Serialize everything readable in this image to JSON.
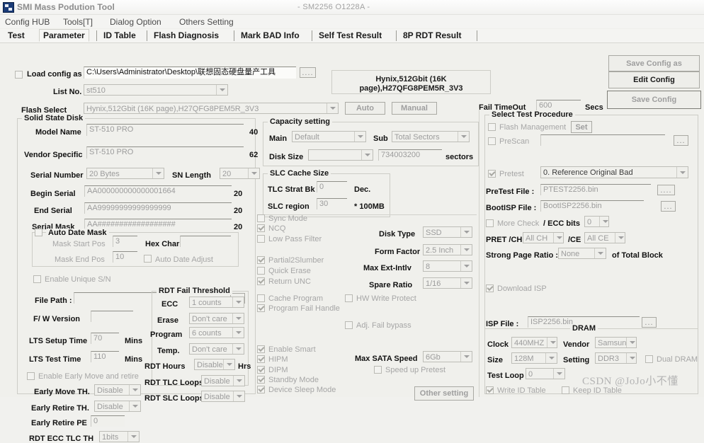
{
  "window": {
    "title": "SMI Mass Podution Tool",
    "subtitle": "- SM2256 O1228A -",
    "icon": "app-icon"
  },
  "menu": [
    "Config HUB",
    "Tools[T]",
    "Dialog Option",
    "Others Setting"
  ],
  "tabs": [
    {
      "label": "Test",
      "selected": false
    },
    {
      "label": "Parameter",
      "selected": true
    },
    {
      "label": "ID Table",
      "selected": false
    },
    {
      "label": "Flash Diagnosis",
      "selected": false
    },
    {
      "label": "Mark BAD Info",
      "selected": false
    },
    {
      "label": "Self Test Result",
      "selected": false
    },
    {
      "label": "8P RDT Result",
      "selected": false
    }
  ],
  "config": {
    "load_config_as_label": "Load config as",
    "load_config_as_checked": false,
    "config_path": "C:\\Users\\Administrator\\Desktop\\联想固态硬盘量产工具",
    "browse_label": "....",
    "list_no_label": "List No.",
    "list_no_value": "st510",
    "flash_select_label": "Flash Select",
    "flash_select_value": "Hynix,512Gbit (16K page),H27QFG8PEM5R_3V3",
    "auto_label": "Auto",
    "manual_label": "Manual",
    "flash_info": "Hynix,512Gbit (16K page),H27QFG8PEM5R_3V3",
    "fail_timeout_label": "Fail TimeOut",
    "fail_timeout_value": "600",
    "secs_label": "Secs",
    "save_config_as_label": "Save Config as",
    "edit_config_label": "Edit Config",
    "save_config_label": "Save Config"
  },
  "ssd": {
    "group_title": "Solid State Disk",
    "model_name_label": "Model Name",
    "model_name_value": "ST-510 PRO",
    "model_name_len": "40",
    "vendor_specific_label": "Vendor Specific",
    "vendor_specific_value": "ST-510 PRO",
    "vendor_specific_len": "62",
    "serial_number_label": "Serial Number",
    "serial_number_value": "20 Bytes",
    "sn_length_label": "SN Length",
    "sn_length_value": "20",
    "begin_serial_label": "Begin Serial",
    "begin_serial_value": "AA000000000000001664",
    "begin_serial_len": "20",
    "end_serial_label": "End Serial",
    "end_serial_value": "AA99999999999999999",
    "end_serial_len": "20",
    "serial_mask_label": "Serial Mask",
    "serial_mask_value": "AA##################",
    "serial_mask_len": "20",
    "auto_date_mask_label": "Auto Date Mask",
    "auto_date_mask_checked": false,
    "mask_start_pos_label": "Mask Start Pos",
    "mask_start_pos_value": "3",
    "mask_end_pos_label": "Mask End Pos",
    "mask_end_pos_value": "10",
    "hex_char_label": "Hex Char:",
    "hex_char_value": "",
    "auto_date_adjust_label": "Auto Date Adjust",
    "auto_date_adjust_checked": false,
    "enable_unique_sn_label": "Enable Unique S/N",
    "enable_unique_sn_checked": false,
    "file_path_label": "File Path :",
    "file_path_value": "",
    "file_path_browse": "....",
    "fw_version_label": "F/ W Version",
    "fw_version_value": "",
    "lts_setup_time_label": "LTS Setup Time",
    "lts_setup_time_value": "70",
    "lts_setup_time_unit": "Mins",
    "lts_test_time_label": "LTS Test Time",
    "lts_test_time_value": "110",
    "lts_test_time_unit": "Mins",
    "enable_early_move_label": "Enable Early Move and retire",
    "enable_early_move_checked": false,
    "early_move_th_label": "Early Move TH.",
    "early_move_th_value": "Disable",
    "early_retire_th_label": "Early Retire TH.",
    "early_retire_th_value": "Disable",
    "early_retire_pe_label": "Early Retire PE",
    "early_retire_pe_value": "0",
    "rdt_ecc_tlc_th_label": "RDT ECC TLC TH",
    "rdt_ecc_tlc_th_value": "1bits"
  },
  "rdt_fail_threshold": {
    "group_title": "RDT Fail Threshold",
    "ecc_label": "ECC",
    "ecc_value": "1 counts",
    "erase_label": "Erase",
    "erase_value": "Don't care",
    "program_label": "Program",
    "program_value": "6 counts",
    "temp_label": "Temp.",
    "temp_value": "Don't care",
    "rdt_hours_label": "RDT Hours",
    "rdt_hours_value": "Disable",
    "rdt_hours_unit": "Hrs",
    "rdt_tlc_loops_label": "RDT TLC Loops",
    "rdt_tlc_loops_value": "Disable",
    "rdt_slc_loops_label": "RDT SLC Loops",
    "rdt_slc_loops_value": "Disable"
  },
  "capacity": {
    "group_title": "Capacity setting",
    "main_label": "Main",
    "main_value": "Default",
    "sub_label": "Sub",
    "sub_value": "Total Sectors",
    "disk_size_label": "Disk Size",
    "disk_size_value": "",
    "total_sectors_value": "734003200",
    "sectors_label": "sectors"
  },
  "slc_cache": {
    "group_title": "SLC Cache Size",
    "tlc_strat_bk_label": "TLC Strat Bk",
    "tlc_strat_bk_value": "0",
    "dec_label": "Dec.",
    "slc_region_label": "SLC region",
    "slc_region_value": "30",
    "mb_label": "* 100MB"
  },
  "flags": [
    {
      "label": "Sync Mode",
      "checked": false
    },
    {
      "label": "NCQ",
      "checked": true
    },
    {
      "label": "Low Pass Filter",
      "checked": false
    },
    {
      "label": "Partial2Slumber",
      "checked": true
    },
    {
      "label": "Quick Erase",
      "checked": false
    },
    {
      "label": "Return UNC",
      "checked": true
    },
    {
      "label": "Cache Program",
      "checked": false
    },
    {
      "label": "Program Fail Handle",
      "checked": true
    },
    {
      "label": "Enable Smart",
      "checked": true
    },
    {
      "label": "HIPM",
      "checked": true
    },
    {
      "label": "DIPM",
      "checked": true
    },
    {
      "label": "Standby Mode",
      "checked": true
    },
    {
      "label": "Device Sleep Mode",
      "checked": true
    }
  ],
  "disk": {
    "disk_type_label": "Disk Type",
    "disk_type_value": "SSD",
    "form_factor_label": "Form Factor",
    "form_factor_value": "2.5 Inch",
    "max_ext_intlv_label": "Max Ext-Intlv",
    "max_ext_intlv_value": "8",
    "spare_ratio_label": "Spare Ratio",
    "spare_ratio_value": "1/16",
    "hw_write_protect_label": "HW Write Protect",
    "hw_write_protect_checked": false,
    "adj_fail_bypass_label": "Adj. Fail bypass",
    "adj_fail_bypass_checked": false,
    "max_sata_speed_label": "Max SATA Speed",
    "max_sata_speed_value": "6Gb",
    "speed_up_pretest_label": "Speed up Pretest",
    "speed_up_pretest_checked": false,
    "other_setting_label": "Other setting"
  },
  "test_procedure": {
    "group_title": "Select Test Procedure",
    "flash_management_label": "Flash Management",
    "flash_management_checked": false,
    "set_label": "Set",
    "prescan_label": "PreScan",
    "prescan_checked": false,
    "prescan_value": "",
    "prescan_browse": "...",
    "pretest_label": "Pretest",
    "pretest_checked": true,
    "pretest_value": "0. Reference Original Bad",
    "pretest_file_label": "PreTest File :",
    "pretest_file_value": "PTEST2256.bin",
    "pretest_file_browse": "....",
    "bootisp_file_label": "BootISP File :",
    "bootisp_file_value": "BootISP2256.bin",
    "bootisp_file_browse": "...",
    "more_check_label": "More Check",
    "more_check_checked": false,
    "ecc_bits_label": "/ ECC bits",
    "ecc_bits_value": "0",
    "pret_ch_label": "PRET /CH",
    "pret_ch_value": "All CH",
    "ce_label": "/CE",
    "ce_value": "All CE",
    "strong_page_ratio_label": "Strong Page Ratio :",
    "strong_page_ratio_value": "None",
    "of_total_block_label": "of Total Block",
    "download_isp_label": "Download ISP",
    "download_isp_checked": true,
    "isp_file_label": "ISP File :",
    "isp_file_value": "ISP2256.bin",
    "isp_file_browse": "..."
  },
  "dram": {
    "group_title": "DRAM",
    "clock_label": "Clock",
    "clock_value": "440MHZ",
    "vendor_label": "Vendor",
    "vendor_value": "Samsun",
    "size_label": "Size",
    "size_value": "128M",
    "setting_label": "Setting",
    "setting_value": "DDR3",
    "dual_dram_label": "Dual DRAM",
    "dual_dram_checked": false,
    "test_loop_label": "Test Loop",
    "test_loop_value": "0",
    "write_id_table_label": "Write ID Table",
    "write_id_table_checked": true,
    "keep_id_table_label": "Keep ID Table",
    "keep_id_table_checked": false
  },
  "watermark": "CSDN @JoJo小不懂"
}
